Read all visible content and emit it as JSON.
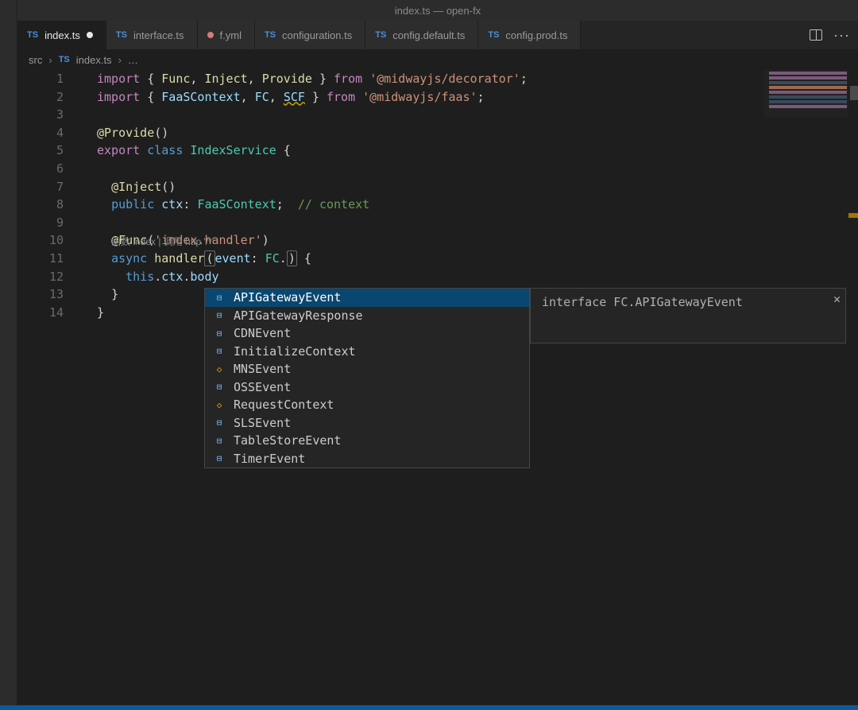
{
  "title": "index.ts — open-fx",
  "tabs": [
    {
      "badge": "TS",
      "label": "index.ts",
      "active": true,
      "dirty": true
    },
    {
      "badge": "TS",
      "label": "interface.ts",
      "active": false,
      "dirty": false
    },
    {
      "badge": "YML",
      "label": "f.yml",
      "active": false,
      "dirty": false
    },
    {
      "badge": "TS",
      "label": "configuration.ts",
      "active": false,
      "dirty": false
    },
    {
      "badge": "TS",
      "label": "config.default.ts",
      "active": false,
      "dirty": false
    },
    {
      "badge": "TS",
      "label": "config.prod.ts",
      "active": false,
      "dirty": false
    }
  ],
  "breadcrumb": {
    "seg1": "src",
    "seg2_badge": "TS",
    "seg2": "index.ts",
    "seg3": "…"
  },
  "code": {
    "lines": [
      1,
      2,
      3,
      4,
      5,
      6,
      7,
      8,
      9,
      10,
      11,
      12,
      13,
      14
    ],
    "l1": {
      "import": "import",
      "lb": "{ ",
      "rb": " }",
      "from": "from",
      "fn1": "Func",
      "fn2": "Inject",
      "fn3": "Provide",
      "mod": "'@midwayjs/decorator'",
      "semi": ";"
    },
    "l2": {
      "import": "import",
      "lb": "{ ",
      "rb": " }",
      "from": "from",
      "t1": "FaaSContext",
      "t2": "FC",
      "t3": "SCF",
      "mod": "'@midwayjs/faas'",
      "semi": ";"
    },
    "l4": {
      "at": "@",
      "dec": "Provide",
      "paren": "()"
    },
    "l5": {
      "export": "export",
      "class": "class",
      "name": "IndexService",
      "lb": " {"
    },
    "l7": {
      "at": "@",
      "dec": "Inject",
      "paren": "()"
    },
    "l8": {
      "public": "public",
      "name": "ctx",
      "colon": ": ",
      "type": "FaaSContext",
      "semi": ";",
      "cmt": "// context"
    },
    "l10": {
      "at": "@",
      "dec": "Func",
      "arg": "'index.handler'"
    },
    "l11": {
      "async": "async",
      "fn": "handler",
      "lp": "(",
      "arg": "event",
      "colon": ": ",
      "type": "FC",
      "dot": ".",
      "rp": ")",
      "brace": " {"
    },
    "l12": {
      "this": "this",
      "dot": ".",
      "p1": "ctx",
      "p2": "body"
    },
    "l13": {
      "brace": "}"
    },
    "l14": {
      "brace": "}"
    }
  },
  "codelens": "函数 index | 调用 http '/*'",
  "suggest": {
    "items": [
      {
        "icon": "interface",
        "label": "APIGatewayEvent"
      },
      {
        "icon": "interface",
        "label": "APIGatewayResponse"
      },
      {
        "icon": "interface",
        "label": "CDNEvent"
      },
      {
        "icon": "interface",
        "label": "InitializeContext"
      },
      {
        "icon": "class",
        "label": "MNSEvent"
      },
      {
        "icon": "interface",
        "label": "OSSEvent"
      },
      {
        "icon": "class",
        "label": "RequestContext"
      },
      {
        "icon": "interface",
        "label": "SLSEvent"
      },
      {
        "icon": "interface",
        "label": "TableStoreEvent"
      },
      {
        "icon": "interface",
        "label": "TimerEvent"
      }
    ],
    "selected": 0
  },
  "suggestDetails": "interface FC.APIGatewayEvent"
}
